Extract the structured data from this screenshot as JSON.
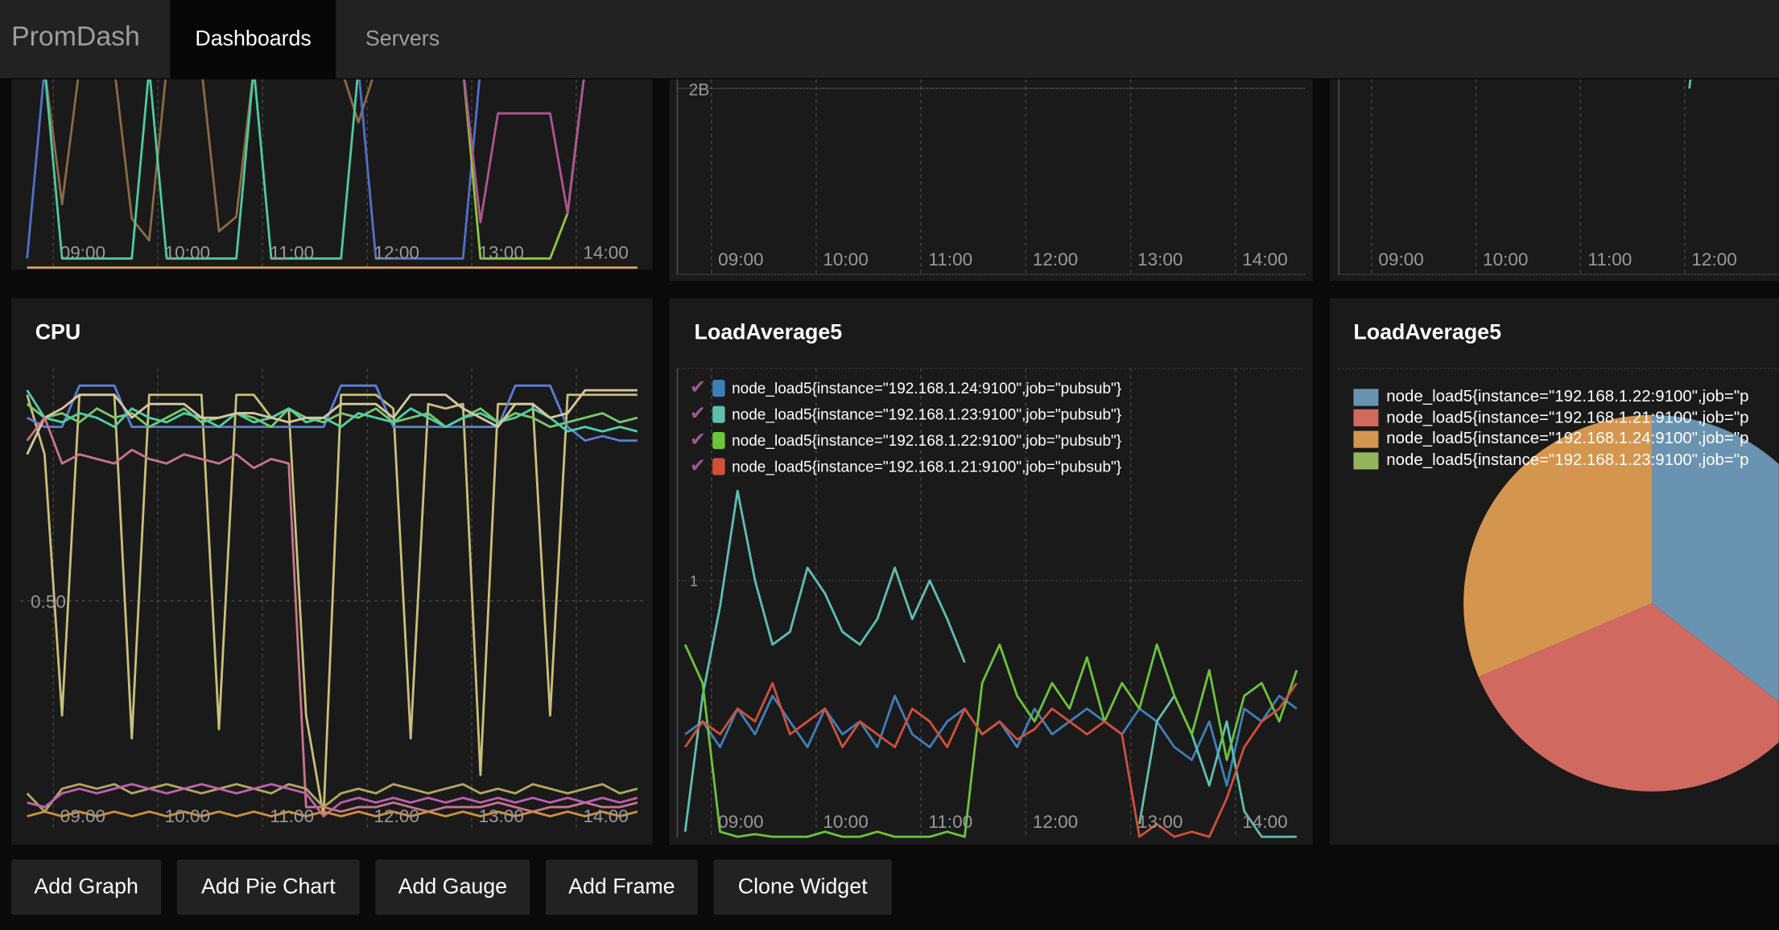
{
  "nav": {
    "brand": "PromDash",
    "tabs": [
      {
        "label": "Dashboards",
        "active": true
      },
      {
        "label": "Servers",
        "active": false
      }
    ]
  },
  "buttons": [
    "Add Graph",
    "Add Pie Chart",
    "Add Gauge",
    "Add Frame",
    "Clone Widget"
  ],
  "colors": {
    "legend_check": "#9b5a8a",
    "panel_bg": "#1a1a1a",
    "nav_bg": "#222222"
  },
  "panels": {
    "top1": {
      "x_ticks": [
        "09:00",
        "10:00",
        "11:00",
        "12:00",
        "13:00",
        "14:00"
      ]
    },
    "top2": {
      "y_tick": "2B",
      "x_ticks": [
        "09:00",
        "10:00",
        "11:00",
        "12:00",
        "13:00",
        "14:00"
      ]
    },
    "top3": {
      "x_ticks": [
        "09:00",
        "10:00",
        "11:00",
        "12:00"
      ]
    },
    "cpu": {
      "title": "CPU",
      "y_tick": "0.50",
      "x_ticks": [
        "09:00",
        "10:00",
        "11:00",
        "12:00",
        "13:00",
        "14:00"
      ]
    },
    "load": {
      "title": "LoadAverage5",
      "y_tick": "1",
      "x_ticks": [
        "09:00",
        "10:00",
        "11:00",
        "12:00",
        "13:00",
        "14:00"
      ],
      "legend": [
        {
          "label": "node_load5{instance=\"192.168.1.24:9100\",job=\"pubsub\"}",
          "color": "#3f7fb8",
          "checked": true
        },
        {
          "label": "node_load5{instance=\"192.168.1.23:9100\",job=\"pubsub\"}",
          "color": "#5fbfae",
          "checked": true
        },
        {
          "label": "node_load5{instance=\"192.168.1.22:9100\",job=\"pubsub\"}",
          "color": "#6cc43a",
          "checked": true
        },
        {
          "label": "node_load5{instance=\"192.168.1.21:9100\",job=\"pubsub\"}",
          "color": "#d0503a",
          "checked": true
        }
      ]
    },
    "pie": {
      "title": "LoadAverage5",
      "legend": [
        {
          "label": "node_load5{instance=\"192.168.1.22:9100\",job=\"p",
          "color": "#6a93b1"
        },
        {
          "label": "node_load5{instance=\"192.168.1.21:9100\",job=\"p",
          "color": "#d0695f"
        },
        {
          "label": "node_load5{instance=\"192.168.1.24:9100\",job=\"p",
          "color": "#d4954e"
        },
        {
          "label": "node_load5{instance=\"192.168.1.23:9100\",job=\"p",
          "color": "#93b55a"
        }
      ]
    }
  },
  "chart_data": [
    {
      "id": "top1",
      "type": "line",
      "grid": true,
      "x": [
        "08:45",
        "08:55",
        "09:05",
        "09:15",
        "09:25",
        "09:35",
        "09:45",
        "09:55",
        "10:05",
        "10:15",
        "10:25",
        "10:35",
        "10:45",
        "10:55",
        "11:05",
        "11:15",
        "11:25",
        "11:35",
        "11:45",
        "11:55",
        "12:05",
        "12:15",
        "12:25",
        "12:35",
        "12:45",
        "12:55",
        "13:05",
        "13:15",
        "13:25",
        "13:35",
        "13:45",
        "13:55",
        "14:05",
        "14:15",
        "14:25",
        "14:35"
      ],
      "series": [
        {
          "color": "#8b6a45",
          "values": [
            1.5,
            1.5,
            0.35,
            1.5,
            1.5,
            1.5,
            0.27,
            0.15,
            1.5,
            1.5,
            1.5,
            0.2,
            0.28,
            1.5,
            1.5,
            1.5,
            1.5,
            1.5,
            1.5,
            0.8,
            1.5,
            1.5,
            1.5,
            1.5,
            1.5,
            1.5,
            1.5,
            1.5,
            1.5,
            1.5,
            1.5,
            1.5,
            1.5,
            1.5,
            1.5,
            1.5
          ]
        },
        {
          "color": "#5470c6",
          "values": [
            0.05,
            1.5,
            1.5,
            1.5,
            1.5,
            1.5,
            1.5,
            1.5,
            1.5,
            1.5,
            1.5,
            1.5,
            1.5,
            1.5,
            1.5,
            1.5,
            1.5,
            1.5,
            1.5,
            1.5,
            0.05,
            0.05,
            0.05,
            0.05,
            0.05,
            0.05,
            1.5,
            1.5,
            1.5,
            1.5,
            1.5,
            1.5,
            1.5,
            1.5,
            1.5,
            1.5
          ]
        },
        {
          "color": "#4fc9a0",
          "values": [
            1.5,
            1.5,
            0.05,
            0.05,
            0.05,
            0.05,
            0.05,
            1.5,
            0.05,
            0.05,
            0.05,
            0.05,
            0.05,
            1.5,
            0.05,
            0.05,
            0.05,
            0.05,
            0.05,
            1.5,
            1.5,
            1.5,
            1.5,
            1.5,
            1.5,
            1.5,
            1.5,
            1.5,
            1.5,
            1.5,
            1.5,
            1.5,
            1.5,
            1.5,
            1.5,
            1.5
          ]
        },
        {
          "color": "#8ccc3c",
          "values": [
            1.5,
            1.5,
            1.5,
            1.5,
            1.5,
            1.5,
            1.5,
            1.5,
            1.5,
            1.5,
            1.5,
            1.5,
            1.5,
            1.5,
            1.5,
            1.5,
            1.5,
            1.5,
            1.5,
            1.5,
            1.5,
            1.5,
            1.5,
            1.5,
            1.5,
            1.5,
            0.05,
            0.05,
            0.05,
            0.05,
            0.05,
            0.3,
            1.5,
            1.5,
            1.5,
            1.5
          ]
        },
        {
          "color": "#b05590",
          "values": [
            1.5,
            1.5,
            1.5,
            1.5,
            1.5,
            1.5,
            1.5,
            1.5,
            1.5,
            1.5,
            1.5,
            1.5,
            1.5,
            1.5,
            1.5,
            1.5,
            1.5,
            1.5,
            1.5,
            1.5,
            1.5,
            1.5,
            1.5,
            1.5,
            1.5,
            1.5,
            0.25,
            0.85,
            0.85,
            0.85,
            0.85,
            0.3,
            1.5,
            1.5,
            1.5,
            1.5
          ]
        },
        {
          "color": "#d8a060",
          "values": [
            0,
            0,
            0,
            0,
            0,
            0,
            0,
            0,
            0,
            0,
            0,
            0,
            0,
            0,
            0,
            0,
            0,
            0,
            0,
            0,
            0,
            0,
            0,
            0,
            0,
            0,
            0,
            0,
            0,
            0,
            0,
            0,
            0,
            0,
            0,
            0
          ]
        }
      ]
    },
    {
      "id": "cpu",
      "type": "line",
      "title": "CPU",
      "grid": true,
      "ylim": [
        0,
        1
      ],
      "x": [
        "08:45",
        "08:55",
        "09:05",
        "09:15",
        "09:25",
        "09:35",
        "09:45",
        "09:55",
        "10:05",
        "10:15",
        "10:25",
        "10:35",
        "10:45",
        "10:55",
        "11:05",
        "11:15",
        "11:25",
        "11:35",
        "11:45",
        "11:55",
        "12:05",
        "12:15",
        "12:25",
        "12:35",
        "12:45",
        "12:55",
        "13:05",
        "13:15",
        "13:25",
        "13:35",
        "13:45",
        "13:55",
        "14:05",
        "14:15",
        "14:25",
        "14:35"
      ],
      "series": [
        {
          "color": "#c7c07a",
          "values": [
            0.95,
            0.82,
            0.25,
            0.95,
            0.95,
            0.95,
            0.2,
            0.95,
            0.95,
            0.95,
            0.95,
            0.22,
            0.95,
            0.95,
            0.9,
            0.92,
            0.25,
            0.03,
            0.95,
            0.95,
            0.95,
            0.92,
            0.2,
            0.93,
            0.92,
            0.93,
            0.12,
            0.93,
            0.93,
            0.93,
            0.25,
            0.95,
            0.95,
            0.95,
            0.95,
            0.95
          ]
        },
        {
          "color": "#5b7fd6",
          "values": [
            0.9,
            0.88,
            0.88,
            0.97,
            0.97,
            0.97,
            0.88,
            0.88,
            0.88,
            0.88,
            0.88,
            0.88,
            0.88,
            0.88,
            0.88,
            0.88,
            0.88,
            0.88,
            0.97,
            0.97,
            0.97,
            0.88,
            0.88,
            0.88,
            0.88,
            0.88,
            0.88,
            0.88,
            0.97,
            0.97,
            0.97,
            0.88,
            0.85,
            0.86,
            0.85,
            0.85
          ]
        },
        {
          "color": "#7bc86a",
          "values": [
            0.93,
            0.9,
            0.91,
            0.89,
            0.92,
            0.9,
            0.91,
            0.88,
            0.9,
            0.92,
            0.89,
            0.9,
            0.91,
            0.9,
            0.88,
            0.92,
            0.9,
            0.89,
            0.91,
            0.9,
            0.92,
            0.89,
            0.9,
            0.91,
            0.88,
            0.9,
            0.92,
            0.89,
            0.91,
            0.9,
            0.88,
            0.89,
            0.9,
            0.91,
            0.89,
            0.9
          ]
        },
        {
          "color": "#4fd0a8",
          "values": [
            0.96,
            0.9,
            0.89,
            0.91,
            0.9,
            0.88,
            0.92,
            0.9,
            0.89,
            0.91,
            0.9,
            0.88,
            0.91,
            0.89,
            0.9,
            0.92,
            0.89,
            0.9,
            0.88,
            0.91,
            0.9,
            0.89,
            0.92,
            0.9,
            0.88,
            0.9,
            0.91,
            0.89,
            0.9,
            0.92,
            0.9,
            0.87,
            0.88,
            0.87,
            0.88,
            0.87
          ]
        },
        {
          "color": "#d8c8a0",
          "values": [
            0.82,
            0.9,
            0.92,
            0.95,
            0.95,
            0.95,
            0.9,
            0.93,
            0.93,
            0.93,
            0.9,
            0.9,
            0.91,
            0.91,
            0.9,
            0.89,
            0.9,
            0.9,
            0.93,
            0.93,
            0.93,
            0.9,
            0.95,
            0.95,
            0.95,
            0.92,
            0.9,
            0.88,
            0.93,
            0.93,
            0.9,
            0.91,
            0.96,
            0.96,
            0.96,
            0.96
          ]
        },
        {
          "color": "#c9748c",
          "values": [
            0.85,
            0.9,
            0.8,
            0.82,
            0.81,
            0.8,
            0.83,
            0.81,
            0.8,
            0.82,
            0.81,
            0.8,
            0.82,
            0.79,
            0.81,
            0.8,
            0.05,
            0.05,
            0.04,
            0.05,
            0.05,
            0.06,
            0.05,
            0.04,
            0.05,
            0.05,
            0.05,
            0.06,
            0.05,
            0.04,
            0.05,
            0.05,
            0.06,
            0.05,
            0.05,
            0.06
          ]
        },
        {
          "color": "#b0a860",
          "values": [
            0.08,
            0.04,
            0.09,
            0.1,
            0.09,
            0.1,
            0.08,
            0.09,
            0.1,
            0.09,
            0.08,
            0.09,
            0.1,
            0.09,
            0.08,
            0.1,
            0.09,
            0.05,
            0.08,
            0.09,
            0.08,
            0.1,
            0.09,
            0.08,
            0.09,
            0.1,
            0.08,
            0.09,
            0.08,
            0.1,
            0.09,
            0.08,
            0.09,
            0.1,
            0.08,
            0.09
          ]
        },
        {
          "color": "#c060b0",
          "values": [
            0.06,
            0.05,
            0.08,
            0.09,
            0.08,
            0.09,
            0.1,
            0.09,
            0.08,
            0.09,
            0.1,
            0.09,
            0.08,
            0.09,
            0.1,
            0.09,
            0.08,
            0.03,
            0.06,
            0.07,
            0.06,
            0.07,
            0.06,
            0.07,
            0.06,
            0.07,
            0.06,
            0.07,
            0.06,
            0.07,
            0.06,
            0.07,
            0.06,
            0.07,
            0.06,
            0.07
          ]
        },
        {
          "color": "#d0903c",
          "values": [
            0.03,
            0.04,
            0.03,
            0.04,
            0.03,
            0.04,
            0.03,
            0.04,
            0.03,
            0.04,
            0.03,
            0.04,
            0.03,
            0.04,
            0.03,
            0.04,
            0.03,
            0.04,
            0.03,
            0.04,
            0.03,
            0.04,
            0.03,
            0.04,
            0.03,
            0.04,
            0.03,
            0.04,
            0.03,
            0.04,
            0.03,
            0.04,
            0.03,
            0.04,
            0.03,
            0.04
          ]
        }
      ]
    },
    {
      "id": "load",
      "type": "line",
      "title": "LoadAverage5",
      "grid": true,
      "legend": "top-left",
      "x": [
        "08:45",
        "08:55",
        "09:05",
        "09:15",
        "09:25",
        "09:35",
        "09:45",
        "09:55",
        "10:05",
        "10:15",
        "10:25",
        "10:35",
        "10:45",
        "10:55",
        "11:05",
        "11:15",
        "11:25",
        "11:35",
        "11:45",
        "11:55",
        "12:05",
        "12:15",
        "12:25",
        "12:35",
        "12:45",
        "12:55",
        "13:05",
        "13:15",
        "13:25",
        "13:35",
        "13:45",
        "13:55",
        "14:05",
        "14:15",
        "14:25",
        "14:35"
      ],
      "series": [
        {
          "name": "node_load5{instance=\"192.168.1.24:9100\",job=\"pubsub\"}",
          "color": "#3f7fb8",
          "values": [
            0.4,
            0.45,
            0.35,
            0.5,
            0.4,
            0.55,
            0.45,
            0.35,
            0.5,
            0.4,
            0.45,
            0.35,
            0.55,
            0.4,
            0.35,
            0.45,
            0.5,
            0.4,
            0.45,
            0.35,
            0.5,
            0.4,
            0.45,
            0.5,
            0.45,
            0.4,
            0.5,
            0.45,
            0.35,
            0.3,
            0.45,
            0.2,
            0.5,
            0.45,
            0.55,
            0.5
          ]
        },
        {
          "name": "node_load5{instance=\"192.168.1.23:9100\",job=\"pubsub\"}",
          "color": "#5fbfae",
          "values": [
            0.02,
            0.55,
            0.9,
            1.35,
            1.0,
            0.75,
            0.8,
            1.05,
            0.95,
            0.8,
            0.75,
            0.85,
            1.05,
            0.85,
            1.0,
            0.85,
            0.68,
            null,
            null,
            null,
            null,
            null,
            null,
            null,
            null,
            null,
            0.05,
            0.45,
            0.55,
            0.4,
            0.2,
            0.45,
            0.1,
            0.0,
            0.0,
            0.0
          ]
        },
        {
          "name": "node_load5{instance=\"192.168.1.22:9100\",job=\"pubsub\"}",
          "color": "#6cc43a",
          "values": [
            0.75,
            0.6,
            0.02,
            0.0,
            0.01,
            0.0,
            0.0,
            0.0,
            0.02,
            0.0,
            0.0,
            0.02,
            0.0,
            0.0,
            0.0,
            0.02,
            0.0,
            0.6,
            0.75,
            0.55,
            0.45,
            0.6,
            0.5,
            0.7,
            0.45,
            0.6,
            0.5,
            0.75,
            0.55,
            0.4,
            0.65,
            0.3,
            0.55,
            0.6,
            0.45,
            0.65
          ]
        },
        {
          "name": "node_load5{instance=\"192.168.1.21:9100\",job=\"pubsub\"}",
          "color": "#d0503a",
          "values": [
            0.35,
            0.45,
            0.4,
            0.5,
            0.45,
            0.6,
            0.4,
            0.45,
            0.5,
            0.35,
            0.45,
            0.4,
            0.35,
            0.5,
            0.45,
            0.35,
            0.5,
            0.4,
            0.45,
            0.38,
            0.42,
            0.5,
            0.45,
            0.4,
            0.45,
            0.4,
            0.0,
            0.05,
            0.0,
            0.02,
            0.0,
            0.15,
            0.35,
            0.45,
            0.5,
            0.6
          ]
        }
      ]
    },
    {
      "id": "pie",
      "type": "pie",
      "title": "LoadAverage5",
      "legend": "top-left",
      "categories": [
        "node_load5{instance=\"192.168.1.22:9100\",job=\"p",
        "node_load5{instance=\"192.168.1.21:9100\",job=\"p",
        "node_load5{instance=\"192.168.1.24:9100\",job=\"p",
        "node_load5{instance=\"192.168.1.23:9100\",job=\"p"
      ],
      "values": [
        35.5,
        33.1,
        31.4,
        0
      ],
      "colors": [
        "#6a93b1",
        "#d0695f",
        "#d4954e",
        "#93b55a"
      ]
    }
  ]
}
